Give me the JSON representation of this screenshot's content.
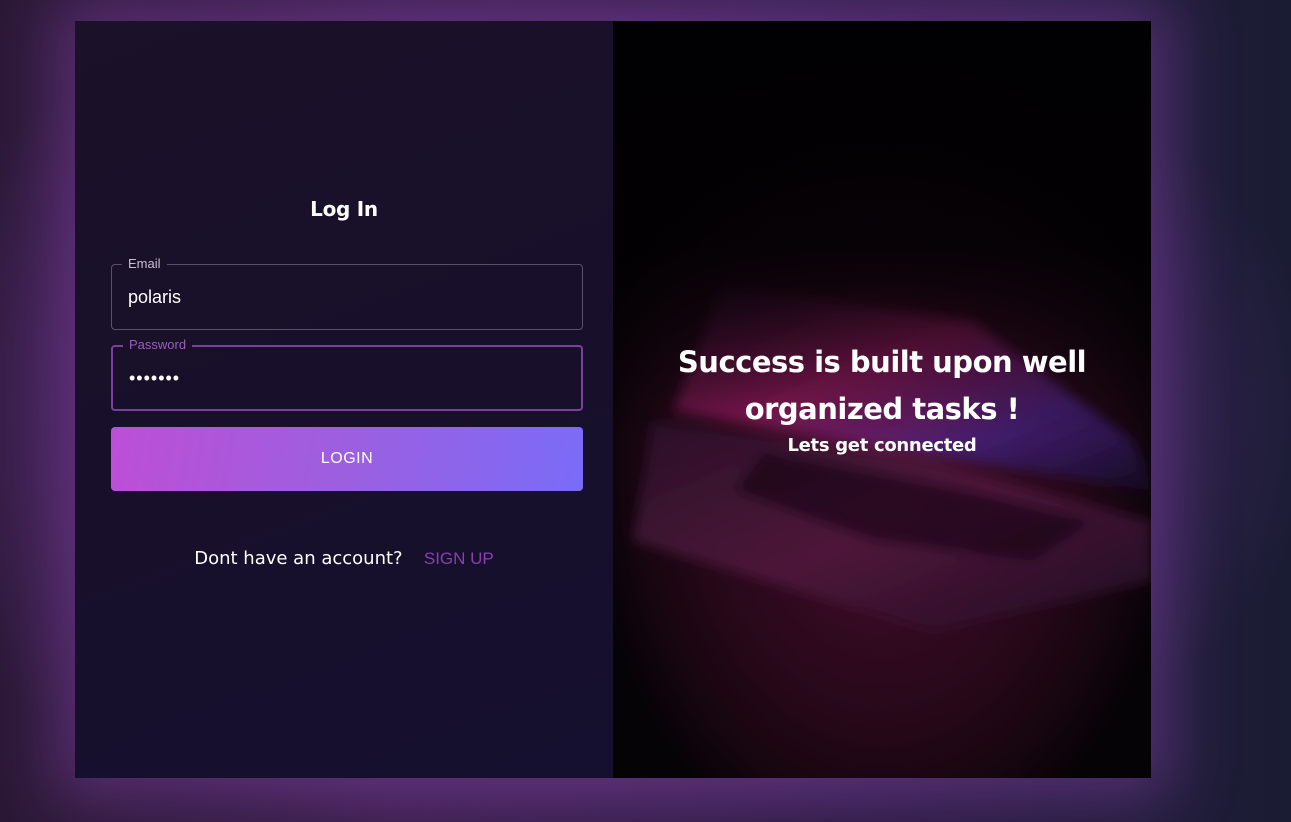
{
  "login": {
    "title": "Log In",
    "email_label": "Email",
    "email_value": "polaris",
    "password_label": "Password",
    "password_value": "•••••••",
    "button_label": "LOGIN",
    "signup_prompt": "Dont have an account?",
    "signup_link": "SIGN UP"
  },
  "hero": {
    "heading": "Success is built upon well organized tasks !",
    "subheading": "Lets get connected"
  },
  "colors": {
    "accent": "#8a3fb0",
    "button_start": "#bd4fd6",
    "button_end": "#7a6cf8",
    "panel_bg": "#18102a"
  },
  "icons": {
    "hero_image": "laptop-image"
  }
}
